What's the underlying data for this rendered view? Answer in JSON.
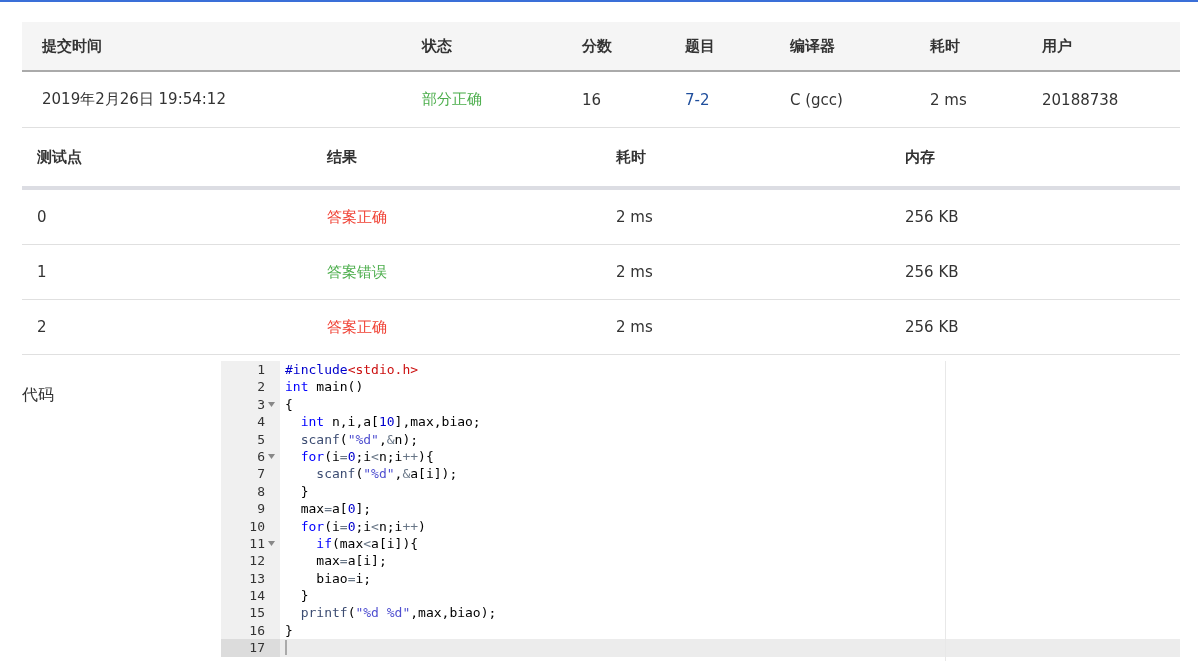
{
  "submission": {
    "columns": [
      "提交时间",
      "状态",
      "分数",
      "题目",
      "编译器",
      "耗时",
      "用户"
    ],
    "row": {
      "time": "2019年2月26日 19:54:12",
      "status": "部分正确",
      "color": "#4cae4c",
      "score": "16",
      "problem": "7-2",
      "compiler": "C (gcc)",
      "duration": "2 ms",
      "user": "20188738"
    }
  },
  "tests": {
    "columns": [
      "测试点",
      "结果",
      "耗时",
      "内存"
    ],
    "rows": [
      {
        "id": "0",
        "result": "答案正确",
        "color": "#f04134",
        "time": "2 ms",
        "memory": "256 KB"
      },
      {
        "id": "1",
        "result": "答案错误",
        "color": "#4cae4c",
        "time": "2 ms",
        "memory": "256 KB"
      },
      {
        "id": "2",
        "result": "答案正确",
        "color": "#f04134",
        "time": "2 ms",
        "memory": "256 KB"
      }
    ]
  },
  "code": {
    "label": "代码",
    "lines": [
      {
        "number": "1",
        "foldable": false,
        "active": false,
        "tokens": [
          {
            "kind": "meta",
            "text": "#include"
          },
          {
            "kind": "inc",
            "text": "<stdio.h>"
          }
        ]
      },
      {
        "number": "2",
        "foldable": false,
        "active": false,
        "tokens": [
          {
            "kind": "kw",
            "text": "int"
          },
          {
            "kind": "plain",
            "text": " main()"
          }
        ]
      },
      {
        "number": "3",
        "foldable": true,
        "active": false,
        "tokens": [
          {
            "kind": "plain",
            "text": "{"
          }
        ]
      },
      {
        "number": "4",
        "foldable": false,
        "active": false,
        "tokens": [
          {
            "kind": "kw",
            "text": "  int"
          },
          {
            "kind": "plain",
            "text": " n,i,a["
          },
          {
            "kind": "num",
            "text": "10"
          },
          {
            "kind": "plain",
            "text": "],max,biao;"
          }
        ]
      },
      {
        "number": "5",
        "foldable": false,
        "active": false,
        "tokens": [
          {
            "kind": "builtin",
            "text": "  scanf"
          },
          {
            "kind": "plain",
            "text": "("
          },
          {
            "kind": "str",
            "text": "\"%d\""
          },
          {
            "kind": "plain",
            "text": ","
          },
          {
            "kind": "op",
            "text": "&"
          },
          {
            "kind": "plain",
            "text": "n);"
          }
        ]
      },
      {
        "number": "6",
        "foldable": true,
        "active": false,
        "tokens": [
          {
            "kind": "kw",
            "text": "  for"
          },
          {
            "kind": "plain",
            "text": "(i"
          },
          {
            "kind": "op",
            "text": "="
          },
          {
            "kind": "num",
            "text": "0"
          },
          {
            "kind": "plain",
            "text": ";i"
          },
          {
            "kind": "op",
            "text": "<"
          },
          {
            "kind": "plain",
            "text": "n;i"
          },
          {
            "kind": "op",
            "text": "++"
          },
          {
            "kind": "plain",
            "text": "){"
          }
        ]
      },
      {
        "number": "7",
        "foldable": false,
        "active": false,
        "tokens": [
          {
            "kind": "builtin",
            "text": "    scanf"
          },
          {
            "kind": "plain",
            "text": "("
          },
          {
            "kind": "str",
            "text": "\"%d\""
          },
          {
            "kind": "plain",
            "text": ","
          },
          {
            "kind": "op",
            "text": "&"
          },
          {
            "kind": "plain",
            "text": "a[i]);"
          }
        ]
      },
      {
        "number": "8",
        "foldable": false,
        "active": false,
        "tokens": [
          {
            "kind": "plain",
            "text": "  }"
          }
        ]
      },
      {
        "number": "9",
        "foldable": false,
        "active": false,
        "tokens": [
          {
            "kind": "plain",
            "text": "  max"
          },
          {
            "kind": "op",
            "text": "="
          },
          {
            "kind": "plain",
            "text": "a["
          },
          {
            "kind": "num",
            "text": "0"
          },
          {
            "kind": "plain",
            "text": "];"
          }
        ]
      },
      {
        "number": "10",
        "foldable": false,
        "active": false,
        "tokens": [
          {
            "kind": "kw",
            "text": "  for"
          },
          {
            "kind": "plain",
            "text": "(i"
          },
          {
            "kind": "op",
            "text": "="
          },
          {
            "kind": "num",
            "text": "0"
          },
          {
            "kind": "plain",
            "text": ";i"
          },
          {
            "kind": "op",
            "text": "<"
          },
          {
            "kind": "plain",
            "text": "n;i"
          },
          {
            "kind": "op",
            "text": "++"
          },
          {
            "kind": "plain",
            "text": ")"
          }
        ]
      },
      {
        "number": "11",
        "foldable": true,
        "active": false,
        "tokens": [
          {
            "kind": "kw",
            "text": "    if"
          },
          {
            "kind": "plain",
            "text": "(max"
          },
          {
            "kind": "op",
            "text": "<"
          },
          {
            "kind": "plain",
            "text": "a[i]){"
          }
        ]
      },
      {
        "number": "12",
        "foldable": false,
        "active": false,
        "tokens": [
          {
            "kind": "plain",
            "text": "    max"
          },
          {
            "kind": "op",
            "text": "="
          },
          {
            "kind": "plain",
            "text": "a[i];"
          }
        ]
      },
      {
        "number": "13",
        "foldable": false,
        "active": false,
        "tokens": [
          {
            "kind": "plain",
            "text": "    biao"
          },
          {
            "kind": "op",
            "text": "="
          },
          {
            "kind": "plain",
            "text": "i;"
          }
        ]
      },
      {
        "number": "14",
        "foldable": false,
        "active": false,
        "tokens": [
          {
            "kind": "plain",
            "text": "  }"
          }
        ]
      },
      {
        "number": "15",
        "foldable": false,
        "active": false,
        "tokens": [
          {
            "kind": "builtin",
            "text": "  printf"
          },
          {
            "kind": "plain",
            "text": "("
          },
          {
            "kind": "str",
            "text": "\"%d %d\""
          },
          {
            "kind": "plain",
            "text": ",max,biao);"
          }
        ]
      },
      {
        "number": "16",
        "foldable": false,
        "active": false,
        "tokens": [
          {
            "kind": "plain",
            "text": "}"
          }
        ]
      },
      {
        "number": "17",
        "foldable": false,
        "active": true
      }
    ]
  }
}
